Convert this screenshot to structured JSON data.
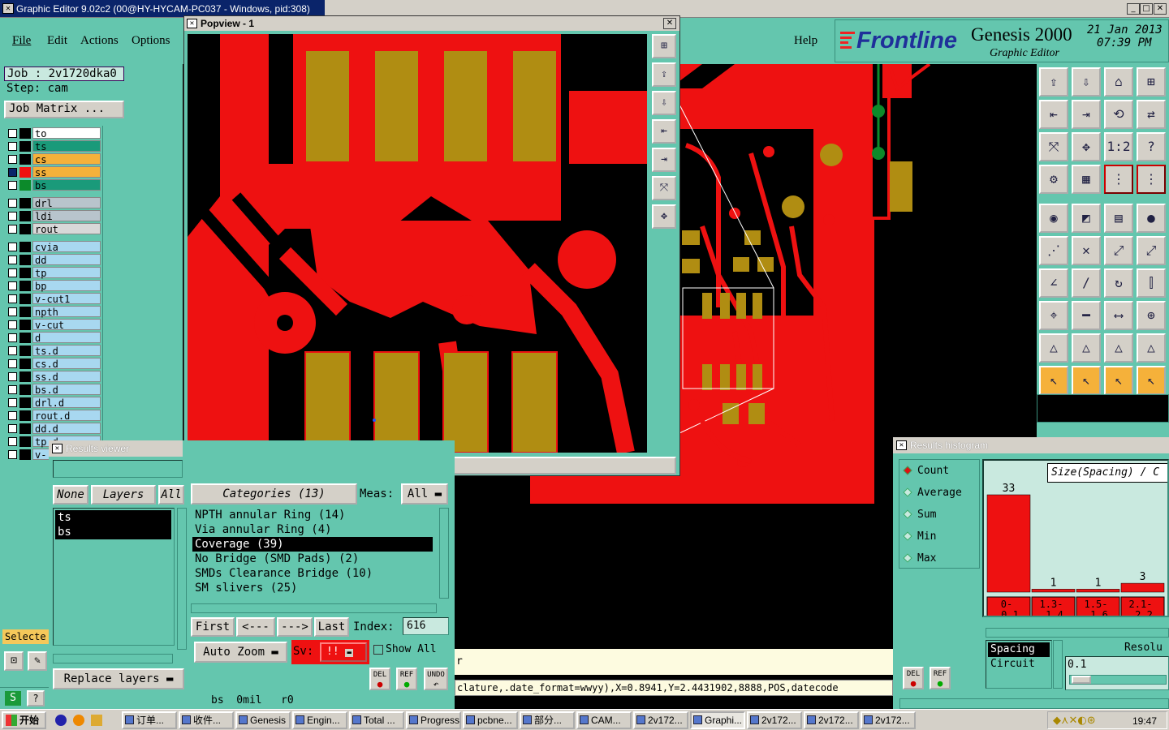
{
  "app": {
    "title": "Graphic Editor 9.02c2 (00@HY-HYCAM-PC037 - Windows, pid:308)"
  },
  "menu": {
    "file": "File",
    "edit": "Edit",
    "actions": "Actions",
    "options": "Options",
    "help": "Help"
  },
  "brand": {
    "logo": "Frontline",
    "product": "Genesis 2000",
    "subtitle": "Graphic Editor",
    "date": "21 Jan 2013",
    "time": "07:39 PM"
  },
  "job": {
    "job_label": "Job : 2v1720dka0",
    "step_label": "Step: cam",
    "matrix_button": "Job Matrix ..."
  },
  "layers": [
    {
      "name": "to",
      "color": "#ffffff"
    },
    {
      "name": "ts",
      "color": "#1a9a7a"
    },
    {
      "name": "cs",
      "color": "#f5b13a"
    },
    {
      "name": "ss",
      "color": "#f5b13a"
    },
    {
      "name": "bs",
      "color": "#1a9a7a"
    },
    {
      "name": "drl",
      "color": "#b8c4cc"
    },
    {
      "name": "ldi",
      "color": "#b8c4cc"
    },
    {
      "name": "rout",
      "color": "#d8d8d8"
    },
    {
      "name": "cvia",
      "color": "#a8d8f0"
    },
    {
      "name": "dd",
      "color": "#a8d8f0"
    },
    {
      "name": "tp",
      "color": "#a8d8f0"
    },
    {
      "name": "bp",
      "color": "#a8d8f0"
    },
    {
      "name": "v-cut1",
      "color": "#a8d8f0"
    },
    {
      "name": "npth",
      "color": "#a8d8f0"
    },
    {
      "name": "v-cut",
      "color": "#a8d8f0"
    },
    {
      "name": "d",
      "color": "#a8d8f0"
    },
    {
      "name": "ts.d",
      "color": "#a8d8f0"
    },
    {
      "name": "cs.d",
      "color": "#a8d8f0"
    },
    {
      "name": "ss.d",
      "color": "#a8d8f0"
    },
    {
      "name": "bs.d",
      "color": "#a8d8f0"
    },
    {
      "name": "drl.d",
      "color": "#a8d8f0"
    },
    {
      "name": "rout.d",
      "color": "#a8d8f0"
    },
    {
      "name": "dd.d",
      "color": "#a8d8f0"
    },
    {
      "name": "tp.d",
      "color": "#a8d8f0"
    },
    {
      "name": "v-",
      "color": "#a8d8f0"
    }
  ],
  "popview": {
    "title": "Popview - 1",
    "close_button": "Close"
  },
  "results_viewer": {
    "title": "Results viewer",
    "none_button": "None",
    "layers_button": "Layers",
    "all_button": "All",
    "layer_list": [
      "ts",
      "bs"
    ],
    "categories_label": "Categories (13)",
    "meas_label": "Meas:",
    "meas_value": "All",
    "categories": [
      "NPTH annular Ring (14)",
      "Via annular Ring (4)",
      "Coverage (39)",
      "No Bridge (SMD Pads) (2)",
      "SMDs Clearance Bridge (10)",
      "SM slivers (25)"
    ],
    "selected_category": 2,
    "first_button": "First",
    "prev_button": "<---",
    "next_button": "--->",
    "last_button": "Last",
    "index_label": "Index:",
    "index_value": "616",
    "auto_zoom": "Auto Zoom",
    "sv_label": "Sv:",
    "sv_value": "!!",
    "show_all": "Show All",
    "replace_layers": "Replace layers",
    "del_button": "DEL",
    "ref_button": "REF",
    "undo_button": "UNDO"
  },
  "left_status": {
    "selected_label": "Selecte"
  },
  "status_line": {
    "coords": "clature,.date_format=wwyy),X=0.8941,Y=2.4431902,8888,POS,datecode",
    "prompt": "r",
    "layer_info": "bs  0mil   r0"
  },
  "histogram": {
    "title": "Results histogram",
    "modes": [
      "Count",
      "Average",
      "Sum",
      "Min",
      "Max"
    ],
    "selected_mode": 0,
    "heading": "Size(Spacing) / C",
    "bins": [
      "0-\n0.1",
      "1.3-\n1.4",
      "1.5-\n1.6",
      "2.1-\n2.2"
    ],
    "bins_top": [
      "0-",
      "1.3-",
      "1.5-",
      "2.1-"
    ],
    "bins_bottom": [
      "0.1",
      "1.4",
      "1.6",
      "2.2"
    ],
    "counts": [
      33,
      1,
      1,
      3
    ],
    "type_list": [
      "Spacing",
      "Circuit"
    ],
    "resolution_label": "Resolu",
    "resolution_value": "0.1",
    "del_button": "DEL",
    "ref_button": "REF"
  },
  "taskbar": {
    "start": "开始",
    "tasks": [
      "订单...",
      "收件...",
      "Genesis",
      "Engin...",
      "Total ...",
      "Progress",
      "pcbne...",
      "部分...",
      "CAM...",
      "2v172...",
      "Graphi...",
      "2v172...",
      "2v172...",
      "2v172..."
    ],
    "clock": "19:47"
  },
  "colors": {
    "panel": "#64c6ae",
    "copper": "#ee1111",
    "pad": "#b08d12",
    "green": "#0c8a2a"
  }
}
